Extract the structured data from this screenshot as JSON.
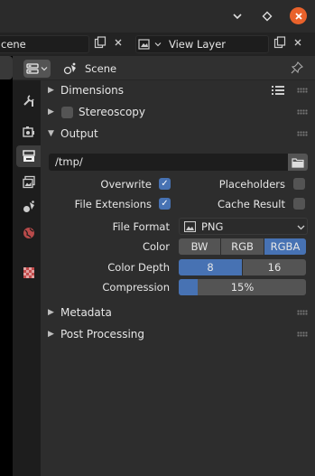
{
  "window": {
    "min_icon": "chevron-down-icon",
    "max_icon": "diamond-icon",
    "close_icon": "close-icon"
  },
  "toprow": {
    "scene_value": "cene",
    "view_layer_value": "View Layer"
  },
  "header": {
    "context_label": "Scene"
  },
  "panels": {
    "dimensions": "Dimensions",
    "stereoscopy": "Stereoscopy",
    "output": "Output",
    "metadata": "Metadata",
    "post_processing": "Post Processing"
  },
  "output": {
    "path": "/tmp/",
    "overwrite_label": "Overwrite",
    "overwrite_checked": true,
    "placeholders_label": "Placeholders",
    "placeholders_checked": false,
    "file_extensions_label": "File Extensions",
    "file_extensions_checked": true,
    "cache_result_label": "Cache Result",
    "cache_result_checked": false,
    "file_format_label": "File Format",
    "file_format_value": "PNG",
    "color_label": "Color",
    "color_options": [
      "BW",
      "RGB",
      "RGBA"
    ],
    "color_selected": "RGBA",
    "color_depth_label": "Color Depth",
    "color_depth_options": [
      "8",
      "16"
    ],
    "color_depth_selected": "8",
    "compression_label": "Compression",
    "compression_value": "15%",
    "compression_fraction": 0.15
  },
  "colors": {
    "accent": "#4772b3",
    "close": "#e9622b"
  }
}
